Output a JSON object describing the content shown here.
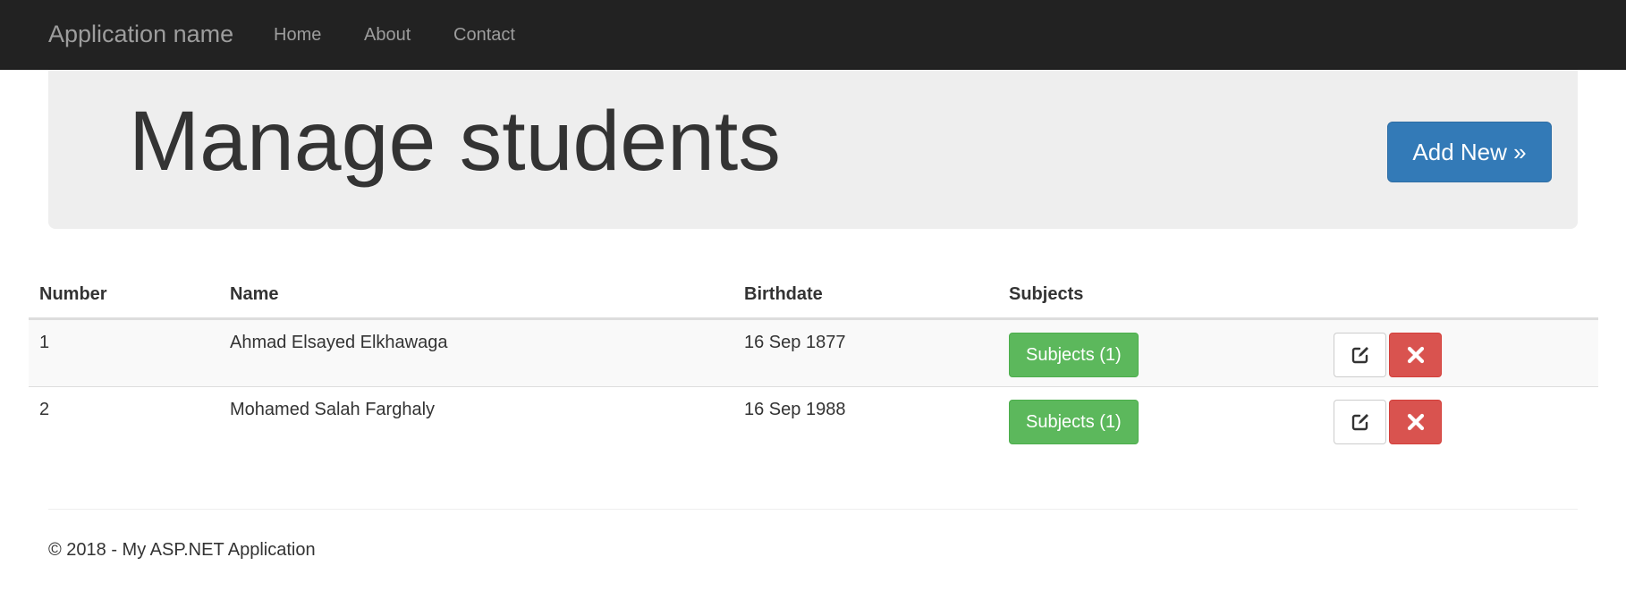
{
  "navbar": {
    "brand": "Application name",
    "links": [
      {
        "label": "Home"
      },
      {
        "label": "About"
      },
      {
        "label": "Contact"
      }
    ]
  },
  "header": {
    "title": "Manage students",
    "add_button": "Add New »"
  },
  "table": {
    "columns": [
      "Number",
      "Name",
      "Birthdate",
      "Subjects",
      ""
    ],
    "rows": [
      {
        "number": "1",
        "name": "Ahmad Elsayed Elkhawaga",
        "birthdate": "16 Sep 1877",
        "subjects_button": "Subjects (1)",
        "edit_icon": "edit-icon",
        "delete_icon": "close-icon"
      },
      {
        "number": "2",
        "name": "Mohamed Salah Farghaly",
        "birthdate": "16 Sep 1988",
        "subjects_button": "Subjects (1)",
        "edit_icon": "edit-icon",
        "delete_icon": "close-icon"
      }
    ]
  },
  "footer": {
    "text": "© 2018 - My ASP.NET Application"
  },
  "colors": {
    "navbar_bg": "#222222",
    "nav_text": "#9d9d9d",
    "jumbotron_bg": "#eeeeee",
    "primary": "#337ab7",
    "success": "#5cb85c",
    "danger": "#d9534f"
  }
}
